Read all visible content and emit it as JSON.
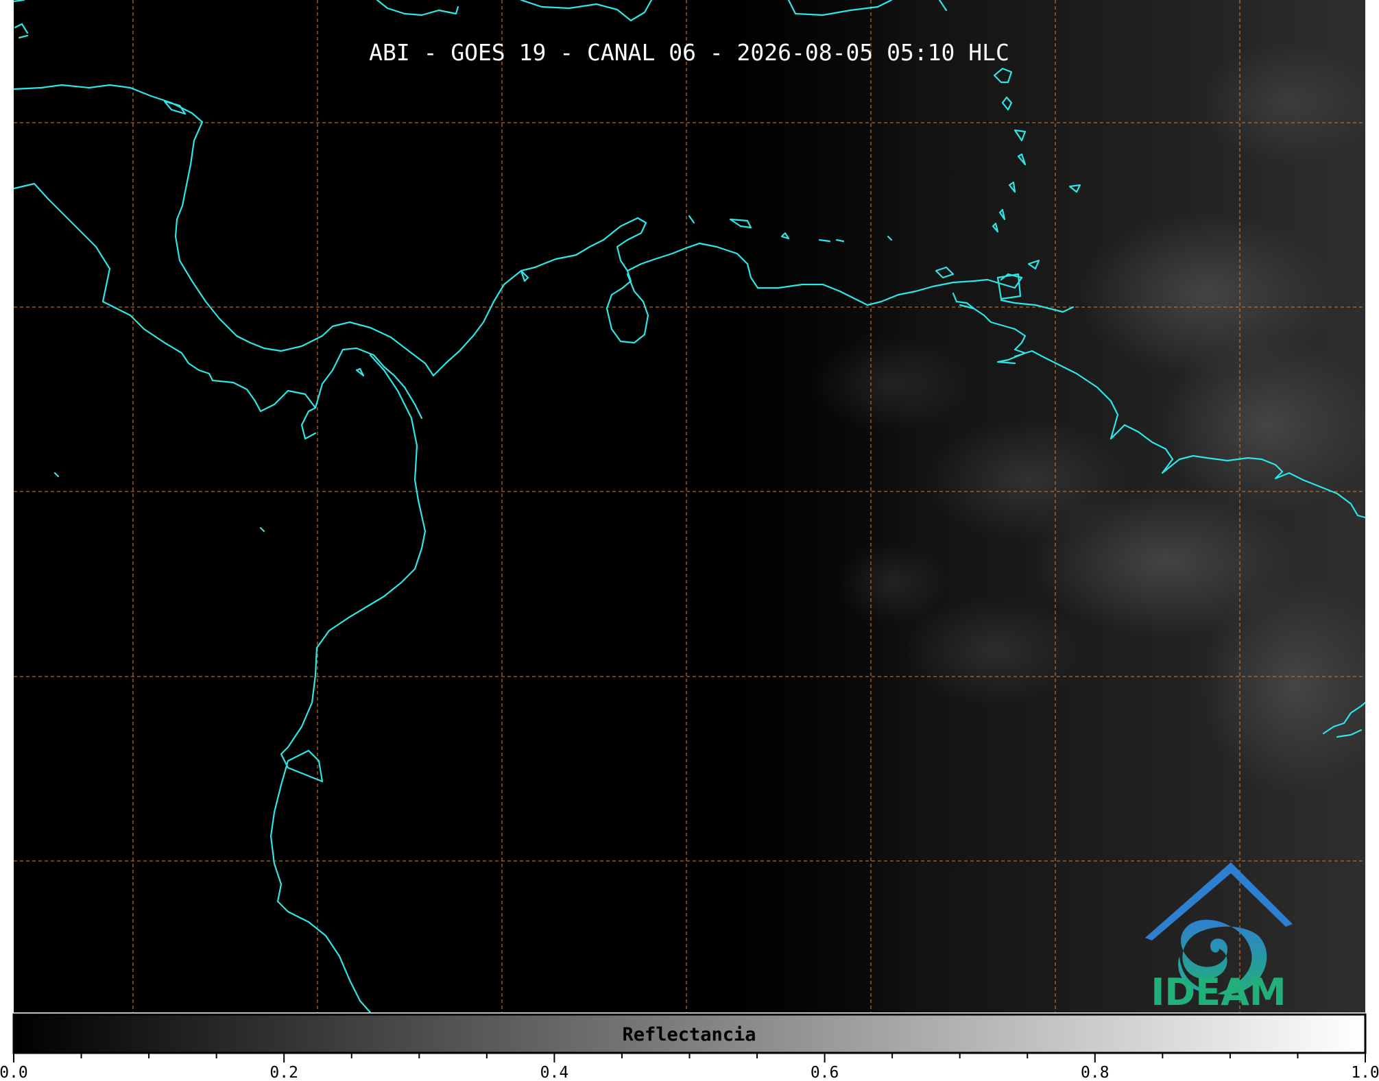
{
  "title": "ABI - GOES 19 - CANAL 06 - 2026-08-05 05:10 HLC",
  "colorbar": {
    "label": "Reflectancia",
    "range": [
      0.0,
      1.0
    ],
    "tick_labels": [
      "0.0",
      "0.2",
      "0.4",
      "0.6",
      "0.8",
      "1.0"
    ],
    "colormap": [
      "#000000",
      "#ffffff"
    ]
  },
  "logo": {
    "text": "IDEAM",
    "text_color": "#22b07a",
    "roof_color": "#2f7fd0",
    "swirl_color": "#2aa8a8"
  },
  "map": {
    "background": "#000000",
    "coastline_color": "#2fe6e6",
    "graticule_color": "#c8722c"
  }
}
